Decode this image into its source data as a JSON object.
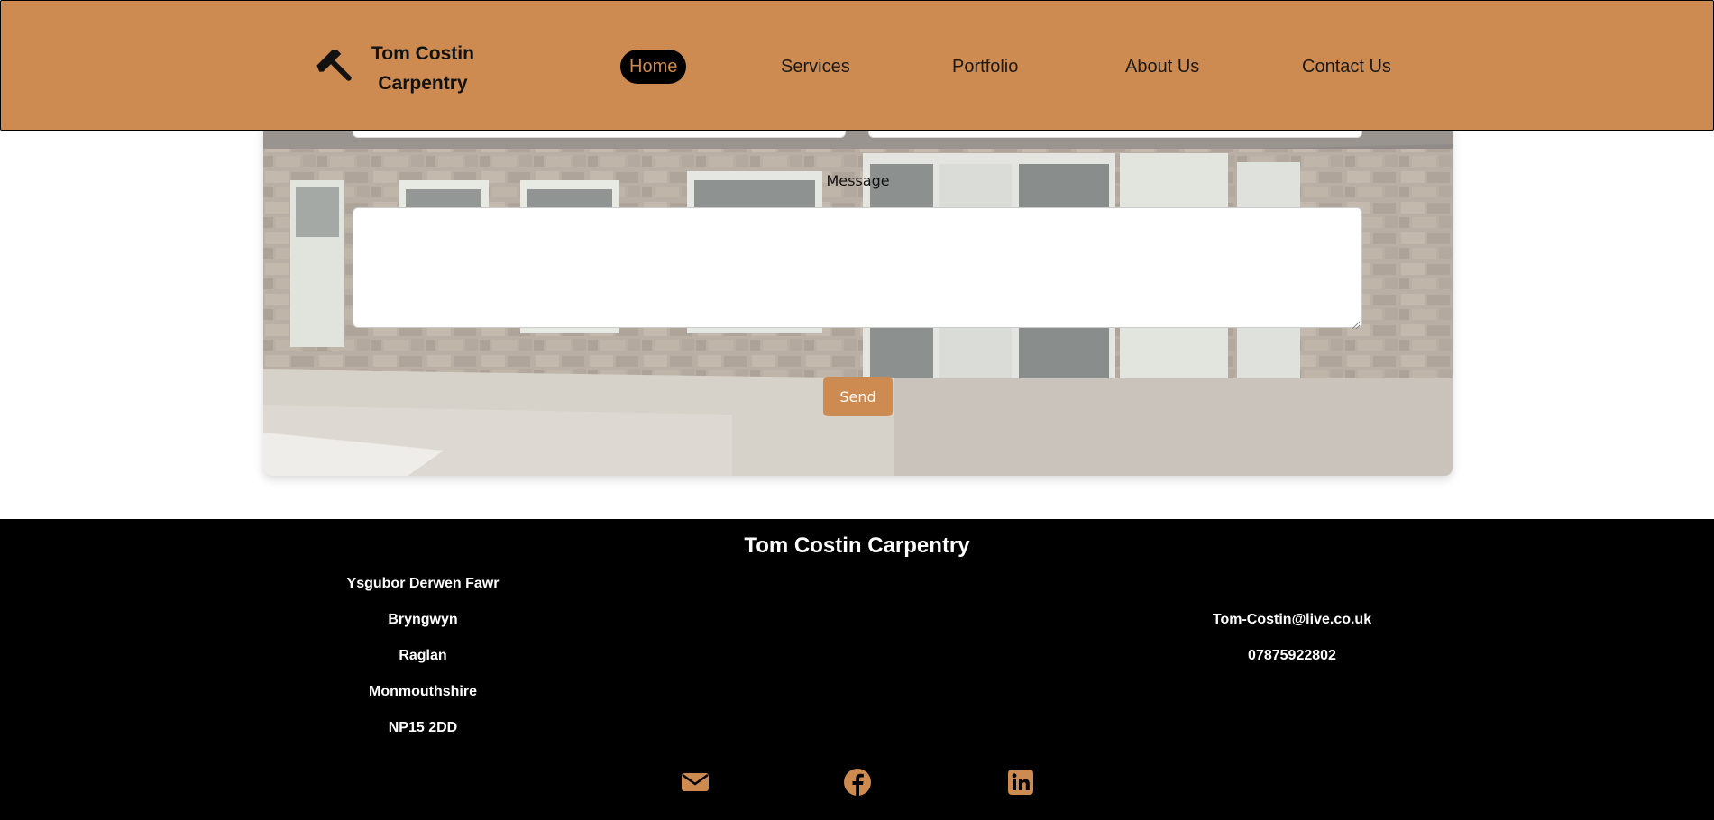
{
  "header": {
    "brand_line1": "Tom Costin",
    "brand_line2": "Carpentry",
    "logo_icon": "hammer-icon",
    "nav": [
      {
        "label": "Home",
        "active": true
      },
      {
        "label": "Services",
        "active": false
      },
      {
        "label": "Portfolio",
        "active": false
      },
      {
        "label": "About Us",
        "active": false
      },
      {
        "label": "Contact Us",
        "active": false
      }
    ]
  },
  "contact_form": {
    "message_label": "Message",
    "message_value": "",
    "send_label": "Send"
  },
  "footer": {
    "title": "Tom Costin Carpentry",
    "address": [
      "Ysgubor Derwen Fawr",
      "Bryngwyn",
      "Raglan",
      "Monmouthshire",
      "NP15 2DD"
    ],
    "email": "Tom-Costin@live.co.uk",
    "phone": "07875922802",
    "social_icons": [
      "envelope-icon",
      "facebook-icon",
      "linkedin-icon"
    ]
  },
  "colors": {
    "accent": "#cd8a51",
    "footer_bg": "#000000",
    "active_nav_bg": "#000000"
  }
}
